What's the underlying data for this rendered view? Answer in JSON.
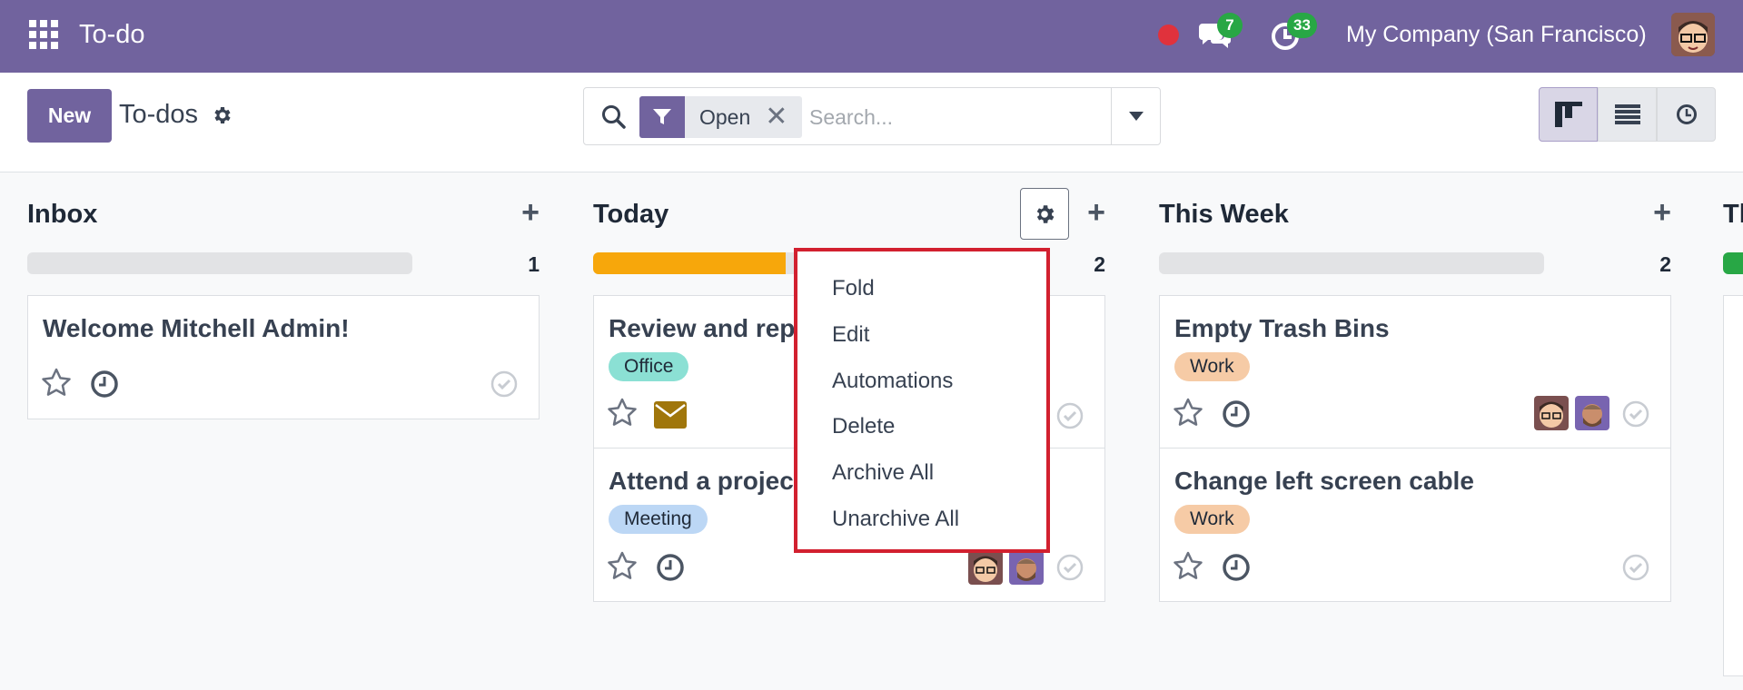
{
  "navbar": {
    "app_title": "To-do",
    "messages_count": "7",
    "activities_count": "33",
    "company": "My Company (San Francisco)",
    "bg_color": "#71639e"
  },
  "control": {
    "new_label": "New",
    "breadcrumb": "To-dos",
    "facet_label": "Open",
    "search_placeholder": "Search..."
  },
  "columns": [
    {
      "title": "Inbox",
      "count": "1",
      "cards": [
        {
          "title": "Welcome Mitchell Admin!"
        }
      ]
    },
    {
      "title": "Today",
      "count": "2",
      "progress_color": "#f7a70b",
      "cards": [
        {
          "title": "Review and rep",
          "tag": "Office",
          "tag_color": "#8be0d4"
        },
        {
          "title": "Attend a projec",
          "tag": "Meeting",
          "tag_color": "#bcd7f5"
        }
      ]
    },
    {
      "title": "This Week",
      "count": "2",
      "cards": [
        {
          "title": "Empty Trash Bins",
          "tag": "Work",
          "tag_color": "#f6cba6"
        },
        {
          "title": "Change left screen cable",
          "tag": "Work",
          "tag_color": "#f6cba6"
        }
      ]
    }
  ],
  "column_menu": {
    "items": [
      "Fold",
      "Edit",
      "Automations",
      "Delete",
      "Archive All",
      "Unarchive All"
    ],
    "highlight_color": "#d2202f"
  },
  "next_column": {
    "title": "Th",
    "progress_color": "#28a745"
  }
}
